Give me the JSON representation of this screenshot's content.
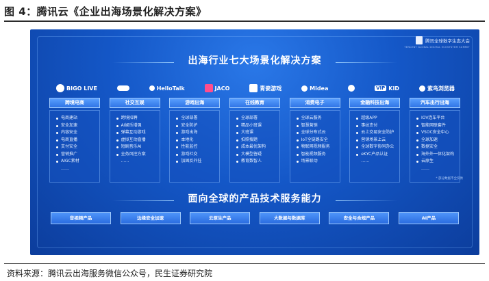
{
  "figure": {
    "title": "图 4：腾讯云《企业出海场景化解决方案》",
    "source": "资料来源：腾讯云出海服务微信公众号，民生证券研究院"
  },
  "slide": {
    "brand": "腾讯全球数字生态大会",
    "brand_sub": "TENCENT GLOBAL DIGITAL ECOSYSTEM SUMMIT",
    "section1_title": "出海行业七大场景化解决方案",
    "section2_title": "面向全球的产品技术服务能力",
    "note": "* 部分数据不全仅供",
    "logos": [
      "BIGO LIVE",
      "",
      "HelloTalk",
      "JACO",
      "青瓷游戏",
      "Midea",
      "",
      "KID",
      "紫鸟浏览器"
    ],
    "columns": [
      {
        "header": "跨境电商",
        "items": [
          "电商建站",
          "安全加速",
          "内容安全",
          "电商直播",
          "支付安全",
          "营销推广",
          "AIGC素材"
        ],
        "more": "……"
      },
      {
        "header": "社交互娱",
        "items": [
          "跨境招聘",
          "AI娱乐增强",
          "弹幕互动游戏",
          "虚拟互动直播",
          "短剧音乐AI",
          "全务风控方案"
        ],
        "more": "……"
      },
      {
        "header": "游戏出海",
        "items": [
          "全球部署",
          "安全防护",
          "游戏出海",
          "本地化",
          "性能监控",
          "游戏社交",
          "加固反外挂"
        ],
        "more": ""
      },
      {
        "header": "在线教育",
        "items": [
          "全球部署",
          "精品小班课",
          "大班课",
          "拍照搜题",
          "成本最优架构",
          "大模型答疑",
          "教育数智人"
        ],
        "more": ""
      },
      {
        "header": "消费电子",
        "items": [
          "全球云服务",
          "智慧营销",
          "全球分布式云",
          "IoT全链路安全",
          "物联网视频服务",
          "智能视频服务",
          "场景联动"
        ],
        "more": ""
      },
      {
        "header": "金融科技出海",
        "items": [
          "超级APP",
          "事纹支付",
          "云上交易安全防护",
          "营销场景上云",
          "全球数字协同办公",
          "eKYC产品认证"
        ],
        "more": "……"
      },
      {
        "header": "汽车出行出海",
        "items": [
          "IOV连车平台",
          "智能网联套件",
          "VSOC安全中心",
          "全球加速",
          "数据安全",
          "海外外一体化架构",
          "云原生"
        ],
        "more": "……"
      }
    ],
    "products": [
      "音视频产品",
      "边缘安全加速",
      "云原生产品",
      "大数据与数据库",
      "安全与合规产品",
      "AI产品"
    ]
  }
}
